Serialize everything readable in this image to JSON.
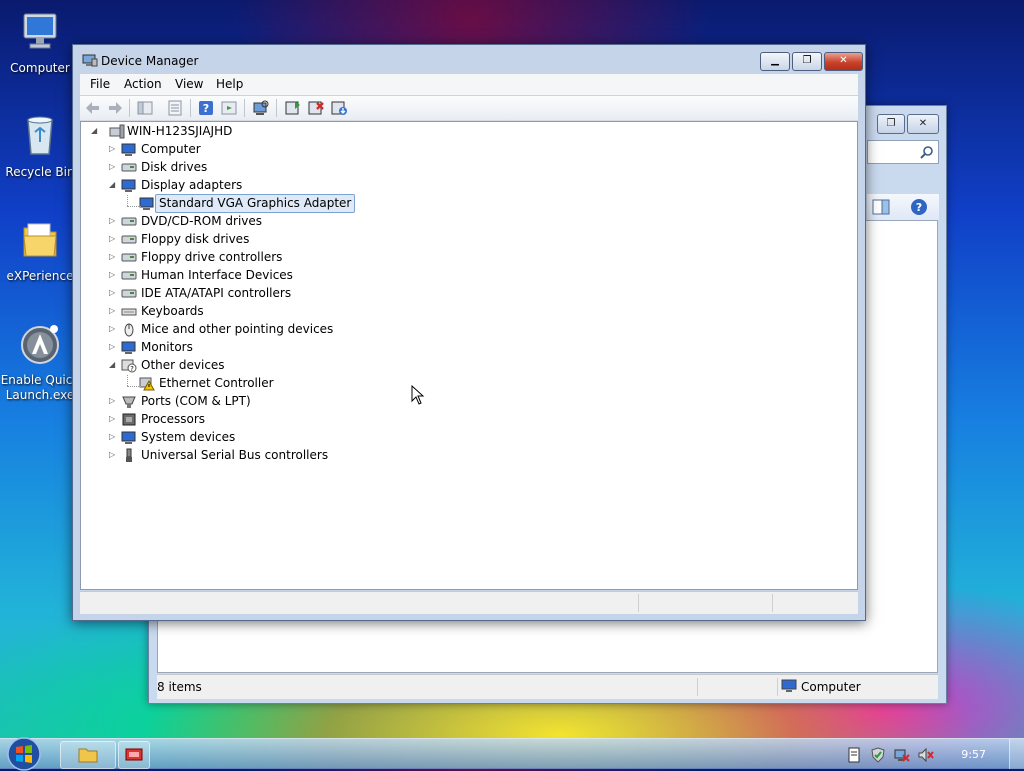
{
  "desktop": {
    "icons": [
      {
        "label": "Computer",
        "icon": "computer-icon"
      },
      {
        "label": "Recycle Bin",
        "icon": "recycle-bin-icon"
      },
      {
        "label": "eXPerience",
        "icon": "folder-icon"
      },
      {
        "label_line1": "Enable Quick",
        "label_line2": "Launch.exe",
        "icon": "quick-launch-icon"
      }
    ]
  },
  "explorer": {
    "status_items": "8 items",
    "status_location": "Computer"
  },
  "device_manager": {
    "title": "Device Manager",
    "menu": [
      "File",
      "Action",
      "View",
      "Help"
    ],
    "tree": {
      "root": "WIN-H123SJIAJHD",
      "items": [
        {
          "label": "Computer",
          "expanded": false
        },
        {
          "label": "Disk drives",
          "expanded": false
        },
        {
          "label": "Display adapters",
          "expanded": true
        },
        {
          "label": "Standard VGA Graphics Adapter",
          "child": true,
          "selected": true
        },
        {
          "label": "DVD/CD-ROM drives",
          "expanded": false
        },
        {
          "label": "Floppy disk drives",
          "expanded": false
        },
        {
          "label": "Floppy drive controllers",
          "expanded": false
        },
        {
          "label": "Human Interface Devices",
          "expanded": false
        },
        {
          "label": "IDE ATA/ATAPI controllers",
          "expanded": false
        },
        {
          "label": "Keyboards",
          "expanded": false
        },
        {
          "label": "Mice and other pointing devices",
          "expanded": false
        },
        {
          "label": "Monitors",
          "expanded": false
        },
        {
          "label": "Other devices",
          "expanded": true
        },
        {
          "label": "Ethernet Controller",
          "child": true,
          "warning": true
        },
        {
          "label": "Ports (COM & LPT)",
          "expanded": false
        },
        {
          "label": "Processors",
          "expanded": false
        },
        {
          "label": "System devices",
          "expanded": false
        },
        {
          "label": "Universal Serial Bus controllers",
          "expanded": false
        }
      ]
    }
  },
  "taskbar": {
    "clock": "9:57"
  },
  "colors": {
    "selection": "#dfeaf8",
    "close_button": "#c8432c",
    "title_bar": "#c5d4e8"
  }
}
